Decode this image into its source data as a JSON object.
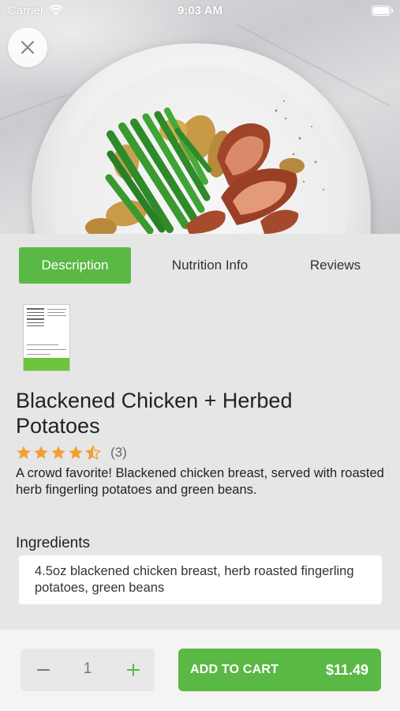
{
  "status_bar": {
    "carrier": "Carrier",
    "time": "9:03 AM"
  },
  "hero": {
    "icon": "close-icon"
  },
  "tabs": [
    {
      "label": "Description",
      "active": true
    },
    {
      "label": "Nutrition Info",
      "active": false
    },
    {
      "label": "Reviews",
      "active": false
    }
  ],
  "product": {
    "title": "Blackened Chicken + Herbed Potatoes",
    "rating": 4.5,
    "review_count": "(3)",
    "description": "A crowd favorite! Blackened chicken breast, served with roasted herb fingerling potatoes and green beans."
  },
  "ingredients": {
    "heading": "Ingredients",
    "text": "4.5oz blackened chicken breast, herb roasted fingerling potatoes, green beans"
  },
  "cart": {
    "quantity": "1",
    "add_label": "ADD TO CART",
    "price": "$11.49"
  },
  "colors": {
    "accent": "#5ab845",
    "star": "#f0a030"
  }
}
